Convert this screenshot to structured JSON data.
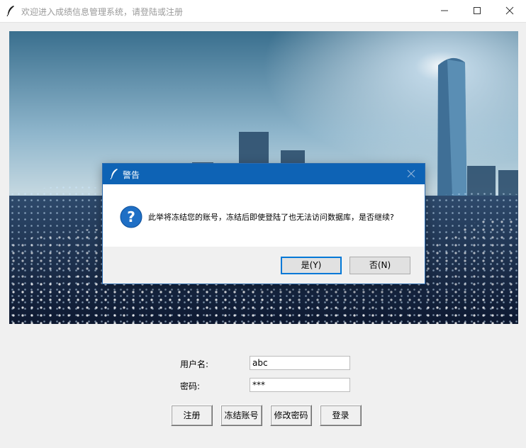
{
  "window": {
    "title": "欢迎进入成绩信息管理系统，请登陆或注册"
  },
  "form": {
    "username_label": "用户名:",
    "username_value": "abc",
    "password_label": "密码:",
    "password_value": "***"
  },
  "buttons": {
    "register": "注册",
    "freeze": "冻结账号",
    "change_password": "修改密码",
    "login": "登录"
  },
  "dialog": {
    "title": "警告",
    "message": "此举将冻结您的账号，冻结后即使登陆了也无法访问数据库，是否继续?",
    "yes_label": "是(Y)",
    "no_label": "否(N)"
  },
  "colors": {
    "dialog_title_bg": "#0e63b5",
    "default_button_border": "#0078d7",
    "window_bg": "#f0f0f0"
  },
  "icons": [
    "feather-icon",
    "minimize-icon",
    "maximize-icon",
    "close-icon",
    "question-icon"
  ]
}
